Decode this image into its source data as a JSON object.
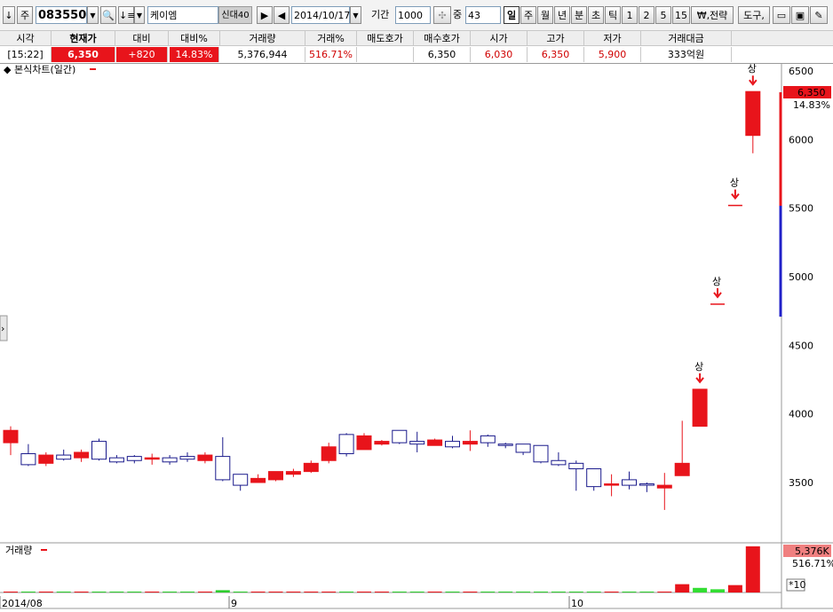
{
  "toolbar": {
    "code": "083550",
    "name": "케이엠",
    "name_badges": [
      "신",
      "대",
      "40"
    ],
    "date": "2014/10/17",
    "period_label": "기간",
    "period_value": "1000",
    "zoom_label": "중",
    "zoom_value": "43",
    "period_buttons": [
      "일",
      "주",
      "월",
      "년",
      "분",
      "초",
      "틱",
      "1",
      "2",
      "5",
      "15"
    ],
    "active_period": "일",
    "strategy_label": "₩,전략",
    "tools_label": "도구,"
  },
  "quote": {
    "headers": [
      "시각",
      "현재가",
      "대비",
      "대비%",
      "거래량",
      "거래%",
      "매도호가",
      "매수호가",
      "시가",
      "고가",
      "저가",
      "거래대금"
    ],
    "time": "[15:22]",
    "price": "6,350",
    "change": "+820",
    "change_pct": "14.83%",
    "volume": "5,376,944",
    "volume_pct": "516.71%",
    "ask": "",
    "bid": "6,350",
    "open": "6,030",
    "high": "6,350",
    "low": "5,900",
    "turnover": "333억원"
  },
  "chart": {
    "main_title": "본식차트(일간)",
    "volume_title": "거래량",
    "limit_up_marker": "상",
    "price_tag": "6,350",
    "pct_tag": "14.83%",
    "volume_tag": "5,376K",
    "volume_pct_tag": "516.71%",
    "volume_scale": "*10",
    "x_labels": [
      "2014/08",
      "9",
      "10"
    ],
    "y_ticks": [
      "6500",
      "6000",
      "5500",
      "5000",
      "4500",
      "4000",
      "3500"
    ]
  },
  "chart_data": {
    "type": "candlestick",
    "title": "본식차트(일간)",
    "ylim": [
      3200,
      6600
    ],
    "y_ticks": [
      3500,
      4000,
      4500,
      5000,
      5500,
      6000,
      6500
    ],
    "x_labels": [
      "2014/08",
      "9",
      "10"
    ],
    "up_color": "#e8141b",
    "down_color": "#1a1a8c",
    "candles": [
      {
        "o": 3790,
        "h": 3910,
        "l": 3700,
        "c": 3880
      },
      {
        "o": 3710,
        "h": 3780,
        "l": 3620,
        "c": 3630
      },
      {
        "o": 3640,
        "h": 3720,
        "l": 3620,
        "c": 3700
      },
      {
        "o": 3700,
        "h": 3740,
        "l": 3660,
        "c": 3670
      },
      {
        "o": 3680,
        "h": 3740,
        "l": 3650,
        "c": 3720
      },
      {
        "o": 3800,
        "h": 3820,
        "l": 3660,
        "c": 3670
      },
      {
        "o": 3680,
        "h": 3700,
        "l": 3640,
        "c": 3650
      },
      {
        "o": 3690,
        "h": 3700,
        "l": 3640,
        "c": 3660
      },
      {
        "o": 3670,
        "h": 3710,
        "l": 3630,
        "c": 3680
      },
      {
        "o": 3680,
        "h": 3700,
        "l": 3630,
        "c": 3650
      },
      {
        "o": 3690,
        "h": 3720,
        "l": 3650,
        "c": 3670
      },
      {
        "o": 3660,
        "h": 3720,
        "l": 3640,
        "c": 3700
      },
      {
        "o": 3690,
        "h": 3830,
        "l": 3510,
        "c": 3520
      },
      {
        "o": 3560,
        "h": 3560,
        "l": 3440,
        "c": 3480
      },
      {
        "o": 3500,
        "h": 3560,
        "l": 3500,
        "c": 3530
      },
      {
        "o": 3520,
        "h": 3580,
        "l": 3510,
        "c": 3580
      },
      {
        "o": 3560,
        "h": 3600,
        "l": 3540,
        "c": 3580
      },
      {
        "o": 3580,
        "h": 3660,
        "l": 3570,
        "c": 3640
      },
      {
        "o": 3660,
        "h": 3790,
        "l": 3640,
        "c": 3760
      },
      {
        "o": 3850,
        "h": 3860,
        "l": 3690,
        "c": 3710
      },
      {
        "o": 3740,
        "h": 3860,
        "l": 3740,
        "c": 3840
      },
      {
        "o": 3780,
        "h": 3810,
        "l": 3770,
        "c": 3800
      },
      {
        "o": 3880,
        "h": 3880,
        "l": 3780,
        "c": 3790
      },
      {
        "o": 3800,
        "h": 3870,
        "l": 3720,
        "c": 3780
      },
      {
        "o": 3770,
        "h": 3820,
        "l": 3770,
        "c": 3810
      },
      {
        "o": 3800,
        "h": 3840,
        "l": 3750,
        "c": 3760
      },
      {
        "o": 3780,
        "h": 3880,
        "l": 3730,
        "c": 3800
      },
      {
        "o": 3840,
        "h": 3850,
        "l": 3760,
        "c": 3790
      },
      {
        "o": 3780,
        "h": 3790,
        "l": 3750,
        "c": 3770
      },
      {
        "o": 3780,
        "h": 3780,
        "l": 3700,
        "c": 3720
      },
      {
        "o": 3770,
        "h": 3770,
        "l": 3640,
        "c": 3650
      },
      {
        "o": 3660,
        "h": 3720,
        "l": 3620,
        "c": 3630
      },
      {
        "o": 3640,
        "h": 3660,
        "l": 3440,
        "c": 3600
      },
      {
        "o": 3600,
        "h": 3600,
        "l": 3440,
        "c": 3470
      },
      {
        "o": 3480,
        "h": 3560,
        "l": 3400,
        "c": 3490
      },
      {
        "o": 3520,
        "h": 3580,
        "l": 3450,
        "c": 3480
      },
      {
        "o": 3490,
        "h": 3500,
        "l": 3430,
        "c": 3480
      },
      {
        "o": 3460,
        "h": 3570,
        "l": 3300,
        "c": 3480
      },
      {
        "o": 3550,
        "h": 3950,
        "l": 3550,
        "c": 3640
      },
      {
        "o": 3910,
        "h": 4180,
        "l": 3910,
        "c": 4180
      },
      {
        "o": 4800,
        "h": 4800,
        "l": 4800,
        "c": 4800
      },
      {
        "o": 5520,
        "h": 5520,
        "l": 5520,
        "c": 5520
      },
      {
        "o": 6030,
        "h": 6350,
        "l": 5900,
        "c": 6350
      }
    ],
    "limit_up_days": [
      39,
      40,
      41,
      42
    ],
    "volume": {
      "values": [
        2,
        2,
        2,
        2,
        2,
        2,
        2,
        2,
        2,
        2,
        2,
        2,
        5,
        2,
        2,
        2,
        2,
        2,
        2,
        2,
        2,
        2,
        2,
        2,
        2,
        2,
        2,
        2,
        2,
        2,
        2,
        2,
        2,
        2,
        2,
        2,
        2,
        2,
        18,
        10,
        7,
        16,
        100
      ],
      "ylim": [
        0,
        100
      ],
      "unit_note": "relative"
    }
  }
}
